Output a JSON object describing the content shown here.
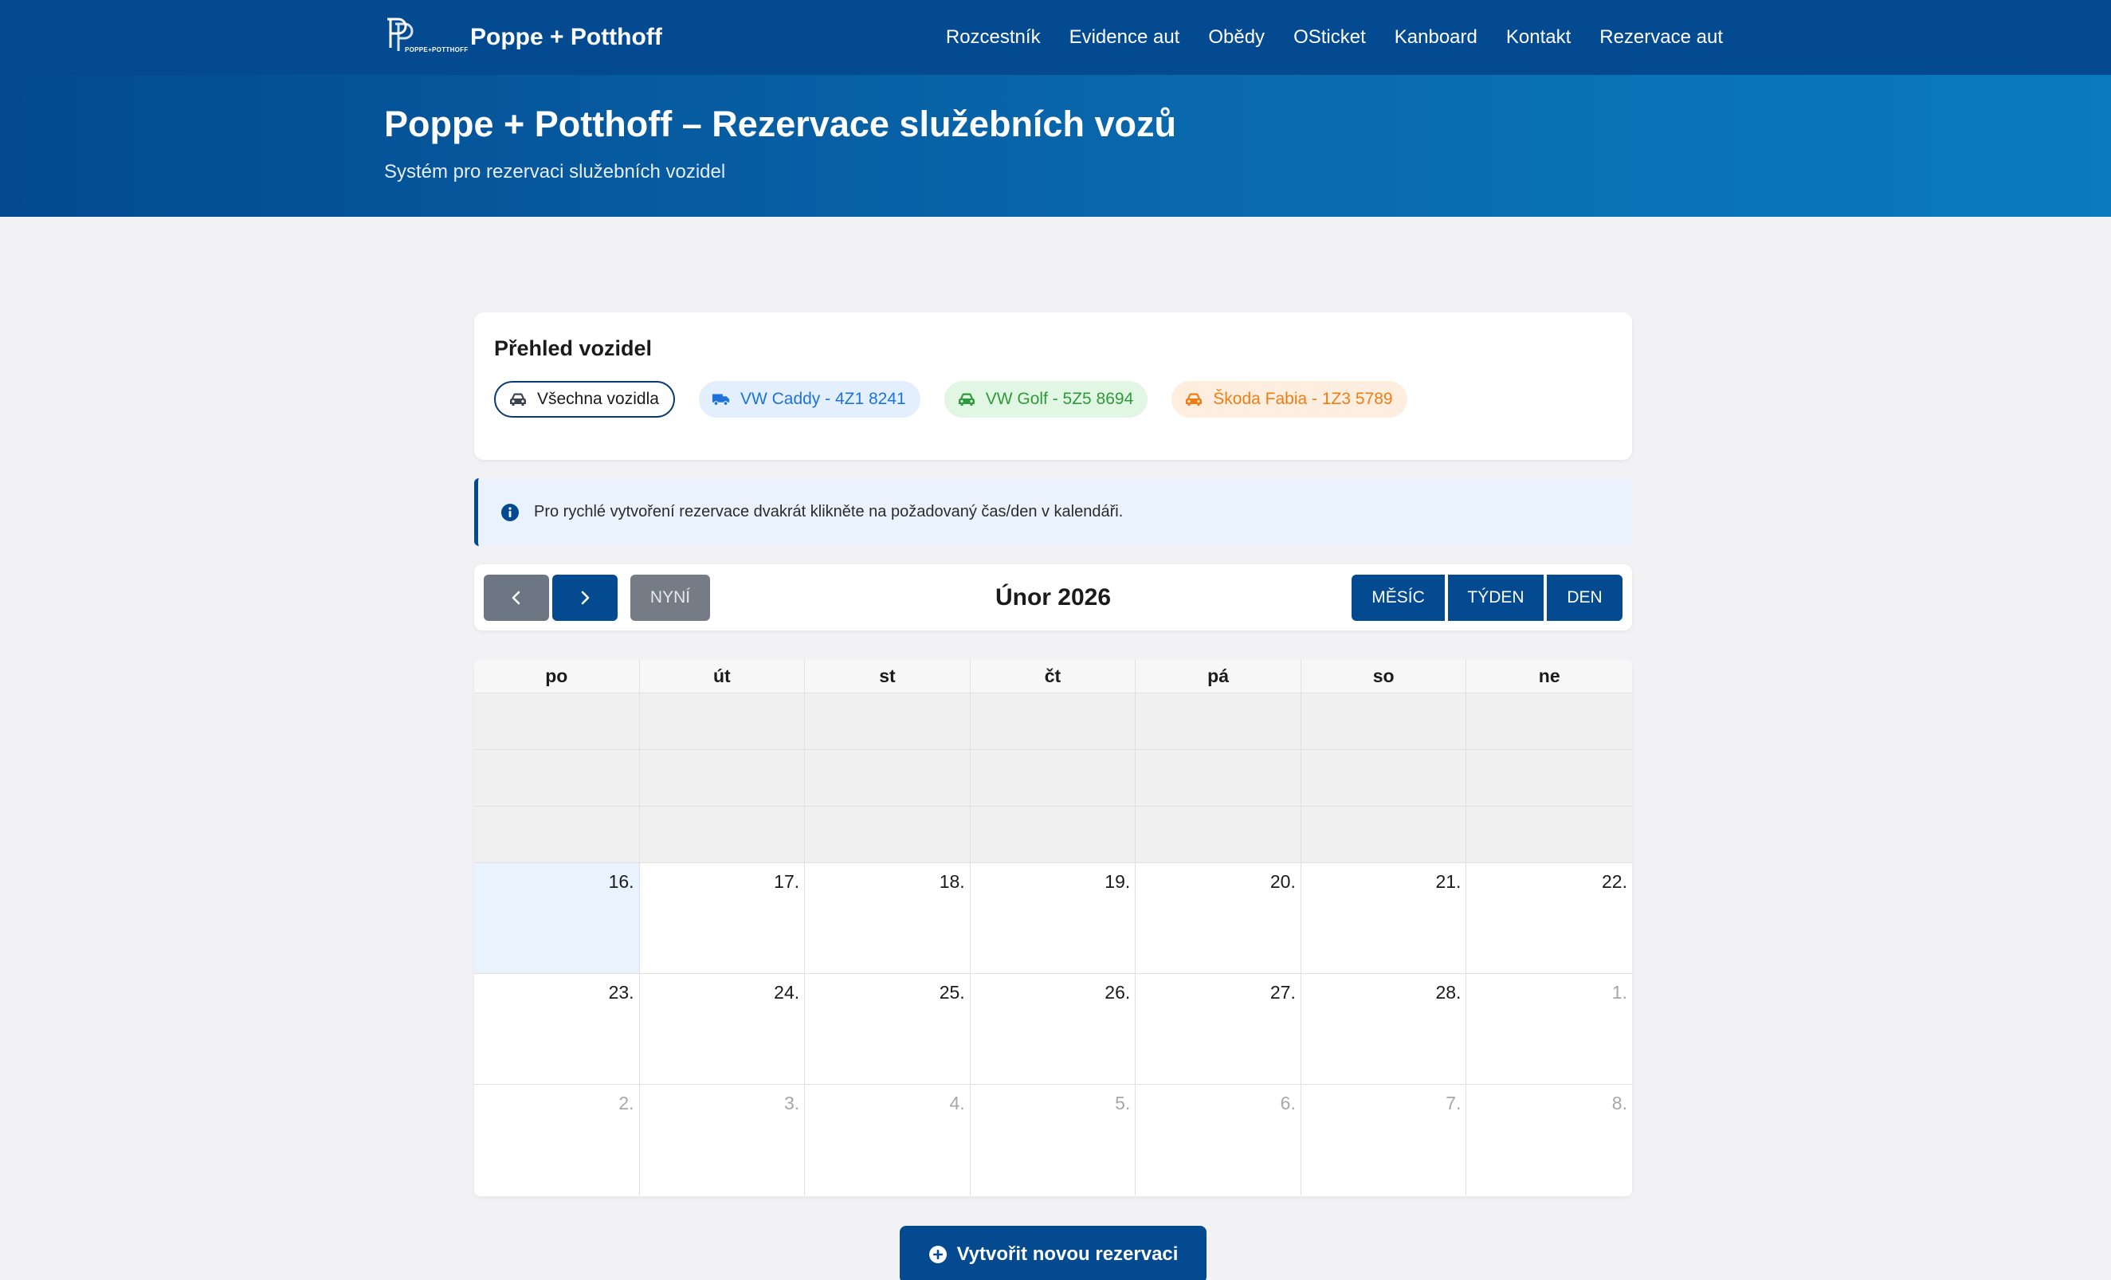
{
  "navbar": {
    "logo_text": "POPPE+POTTHOFF",
    "brand_name": "Poppe + Potthoff",
    "links": [
      "Rozcestník",
      "Evidence aut",
      "Obědy",
      "OSticket",
      "Kanboard",
      "Kontakt",
      "Rezervace aut"
    ]
  },
  "hero": {
    "title": "Poppe + Potthoff – Rezervace služebních vozů",
    "subtitle": "Systém pro rezervaci služebních vozidel"
  },
  "vehicles": {
    "title": "Přehled vozidel",
    "items": [
      {
        "label": "Všechna vozidla",
        "icon": "car-icon",
        "color": "#1b1b1b"
      },
      {
        "label": "VW Caddy - 4Z1 8241",
        "icon": "truck-icon",
        "color": "#1e73d8"
      },
      {
        "label": "VW Golf - 5Z5 8694",
        "icon": "car-icon",
        "color": "#2e9b3a"
      },
      {
        "label": "Škoda Fabia - 1Z3 5789",
        "icon": "car-icon",
        "color": "#f07d14"
      }
    ]
  },
  "info": {
    "icon": "info-icon",
    "text": "Pro rychlé vytvoření rezervace dvakrát klikněte na požadovaný čas/den v kalendáři."
  },
  "toolbar": {
    "prev_icon": "chevron-left-icon",
    "next_icon": "chevron-right-icon",
    "today_label": "NYNÍ",
    "title": "Únor 2026",
    "views": [
      "MĚSÍC",
      "TÝDEN",
      "DEN"
    ]
  },
  "calendar": {
    "weekdays": [
      "po",
      "út",
      "st",
      "čt",
      "pá",
      "so",
      "ne"
    ],
    "blank_rows": 3,
    "weeks": [
      [
        {
          "n": "16.",
          "today": true
        },
        {
          "n": "17."
        },
        {
          "n": "18."
        },
        {
          "n": "19."
        },
        {
          "n": "20."
        },
        {
          "n": "21."
        },
        {
          "n": "22."
        }
      ],
      [
        {
          "n": "23."
        },
        {
          "n": "24."
        },
        {
          "n": "25."
        },
        {
          "n": "26."
        },
        {
          "n": "27."
        },
        {
          "n": "28."
        },
        {
          "n": "1.",
          "other": true
        }
      ],
      [
        {
          "n": "2.",
          "other": true
        },
        {
          "n": "3.",
          "other": true
        },
        {
          "n": "4.",
          "other": true
        },
        {
          "n": "5.",
          "other": true
        },
        {
          "n": "6.",
          "other": true
        },
        {
          "n": "7.",
          "other": true
        },
        {
          "n": "8.",
          "other": true
        }
      ]
    ]
  },
  "create_button": {
    "icon": "plus-circle-icon",
    "label": "Vytvořit novou rezervaci"
  },
  "colors": {
    "primary": "#034a91",
    "today_bg": "#e8f3fd"
  }
}
